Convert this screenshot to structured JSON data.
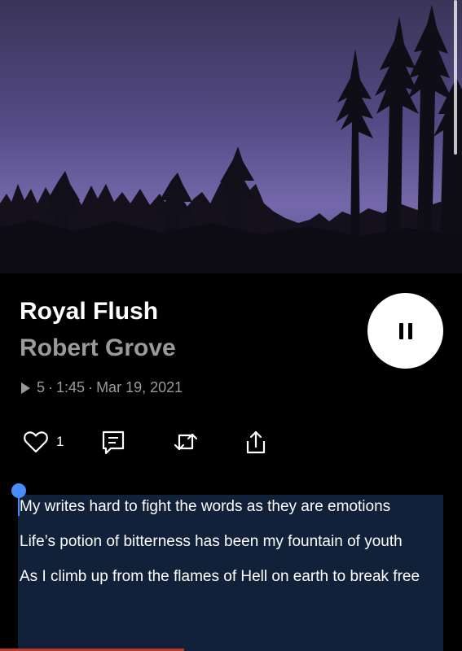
{
  "track": {
    "title": "Royal Flush",
    "artist": "Robert Grove",
    "plays": "5",
    "separator": "·",
    "duration": "1:45",
    "date": "Mar 19, 2021"
  },
  "actions": {
    "like_count": "1",
    "icons": [
      "heart-icon",
      "comment-icon",
      "repost-icon",
      "share-icon"
    ]
  },
  "player": {
    "state": "playing",
    "control_icon": "pause-icon"
  },
  "lyrics": [
    "My writes hard to fight the words as they are emotions",
    "Life’s potion of bitterness has been my fountain of youth",
    "As I climb up from the flames of Hell on earth to break free"
  ],
  "colors": {
    "background": "#000000",
    "secondary_text": "#9a9a9a",
    "selection": "#12213a",
    "selection_handle": "#4a8cff",
    "sky": "#6a5fa0"
  }
}
